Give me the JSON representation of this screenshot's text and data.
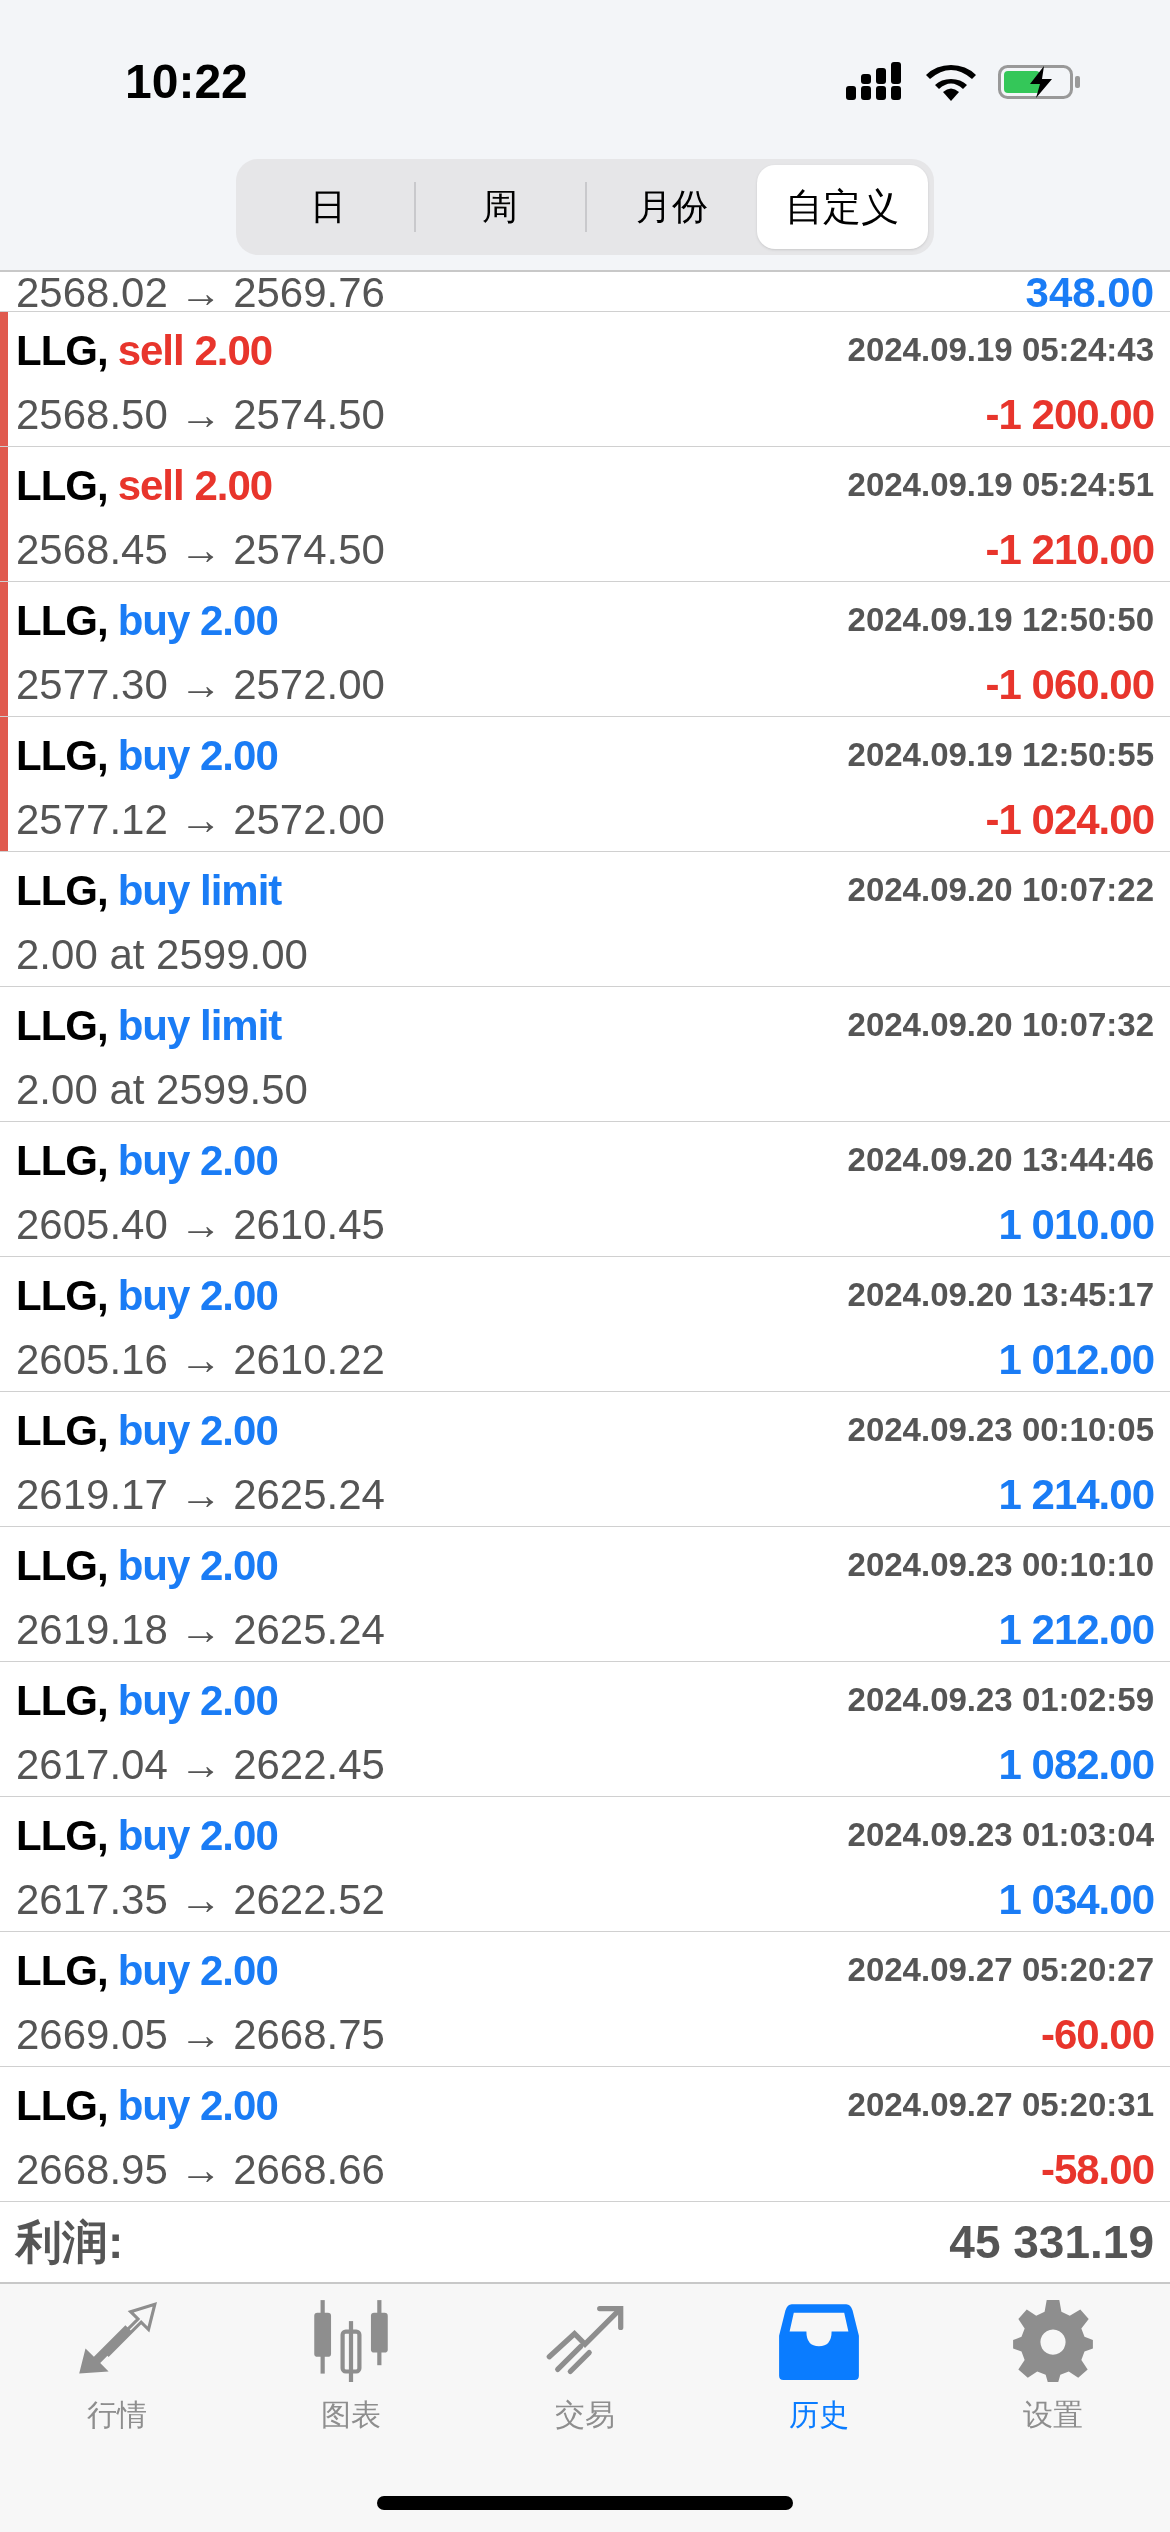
{
  "status_bar": {
    "time": "10:22"
  },
  "segments": [
    {
      "label": "日",
      "selected": false
    },
    {
      "label": "周",
      "selected": false
    },
    {
      "label": "月份",
      "selected": false
    },
    {
      "label": "自定义",
      "selected": true
    }
  ],
  "partial_row": {
    "prices": "2568.02 → 2569.76",
    "profit": {
      "text": "348.00",
      "color": "#1a7cf5"
    }
  },
  "rows": [
    {
      "kind": "deal",
      "symbol": "LLG,",
      "action": {
        "text": "sell 2.00",
        "color": "#e8352c"
      },
      "time": "2024.09.19 05:24:43",
      "prices": "2568.50 → 2574.50",
      "profit": {
        "text": "-1 200.00",
        "color": "#e8352c"
      },
      "marked": true
    },
    {
      "kind": "deal",
      "symbol": "LLG,",
      "action": {
        "text": "sell 2.00",
        "color": "#e8352c"
      },
      "time": "2024.09.19 05:24:51",
      "prices": "2568.45 → 2574.50",
      "profit": {
        "text": "-1 210.00",
        "color": "#e8352c"
      },
      "marked": true
    },
    {
      "kind": "deal",
      "symbol": "LLG,",
      "action": {
        "text": "buy 2.00",
        "color": "#1a7cf5"
      },
      "time": "2024.09.19 12:50:50",
      "prices": "2577.30 → 2572.00",
      "profit": {
        "text": "-1 060.00",
        "color": "#e8352c"
      },
      "marked": true
    },
    {
      "kind": "deal",
      "symbol": "LLG,",
      "action": {
        "text": "buy 2.00",
        "color": "#1a7cf5"
      },
      "time": "2024.09.19 12:50:55",
      "prices": "2577.12 → 2572.00",
      "profit": {
        "text": "-1 024.00",
        "color": "#e8352c"
      },
      "marked": true
    },
    {
      "kind": "order",
      "symbol": "LLG,",
      "action": {
        "text": "buy limit",
        "color": "#1a7cf5"
      },
      "time": "2024.09.20 10:07:22",
      "prices": "2.00 at 2599.00",
      "marked": false
    },
    {
      "kind": "order",
      "symbol": "LLG,",
      "action": {
        "text": "buy limit",
        "color": "#1a7cf5"
      },
      "time": "2024.09.20 10:07:32",
      "prices": "2.00 at 2599.50",
      "marked": false
    },
    {
      "kind": "deal",
      "symbol": "LLG,",
      "action": {
        "text": "buy 2.00",
        "color": "#1a7cf5"
      },
      "time": "2024.09.20 13:44:46",
      "prices": "2605.40 → 2610.45",
      "profit": {
        "text": "1 010.00",
        "color": "#1a7cf5"
      },
      "marked": false
    },
    {
      "kind": "deal",
      "symbol": "LLG,",
      "action": {
        "text": "buy 2.00",
        "color": "#1a7cf5"
      },
      "time": "2024.09.20 13:45:17",
      "prices": "2605.16 → 2610.22",
      "profit": {
        "text": "1 012.00",
        "color": "#1a7cf5"
      },
      "marked": false
    },
    {
      "kind": "deal",
      "symbol": "LLG,",
      "action": {
        "text": "buy 2.00",
        "color": "#1a7cf5"
      },
      "time": "2024.09.23 00:10:05",
      "prices": "2619.17 → 2625.24",
      "profit": {
        "text": "1 214.00",
        "color": "#1a7cf5"
      },
      "marked": false
    },
    {
      "kind": "deal",
      "symbol": "LLG,",
      "action": {
        "text": "buy 2.00",
        "color": "#1a7cf5"
      },
      "time": "2024.09.23 00:10:10",
      "prices": "2619.18 → 2625.24",
      "profit": {
        "text": "1 212.00",
        "color": "#1a7cf5"
      },
      "marked": false
    },
    {
      "kind": "deal",
      "symbol": "LLG,",
      "action": {
        "text": "buy 2.00",
        "color": "#1a7cf5"
      },
      "time": "2024.09.23 01:02:59",
      "prices": "2617.04 → 2622.45",
      "profit": {
        "text": "1 082.00",
        "color": "#1a7cf5"
      },
      "marked": false
    },
    {
      "kind": "deal",
      "symbol": "LLG,",
      "action": {
        "text": "buy 2.00",
        "color": "#1a7cf5"
      },
      "time": "2024.09.23 01:03:04",
      "prices": "2617.35 → 2622.52",
      "profit": {
        "text": "1 034.00",
        "color": "#1a7cf5"
      },
      "marked": false
    },
    {
      "kind": "deal",
      "symbol": "LLG,",
      "action": {
        "text": "buy 2.00",
        "color": "#1a7cf5"
      },
      "time": "2024.09.27 05:20:27",
      "prices": "2669.05 → 2668.75",
      "profit": {
        "text": "-60.00",
        "color": "#e8352c"
      },
      "marked": false
    },
    {
      "kind": "deal",
      "symbol": "LLG,",
      "action": {
        "text": "buy 2.00",
        "color": "#1a7cf5"
      },
      "time": "2024.09.27 05:20:31",
      "prices": "2668.95 → 2668.66",
      "profit": {
        "text": "-58.00",
        "color": "#e8352c"
      },
      "marked": false
    }
  ],
  "total": {
    "label": "利润:",
    "value": "45 331.19"
  },
  "tab_bar": [
    {
      "label": "行情",
      "selected": false
    },
    {
      "label": "图表",
      "selected": false
    },
    {
      "label": "交易",
      "selected": false
    },
    {
      "label": "历史",
      "selected": true
    },
    {
      "label": "设置",
      "selected": false
    }
  ]
}
